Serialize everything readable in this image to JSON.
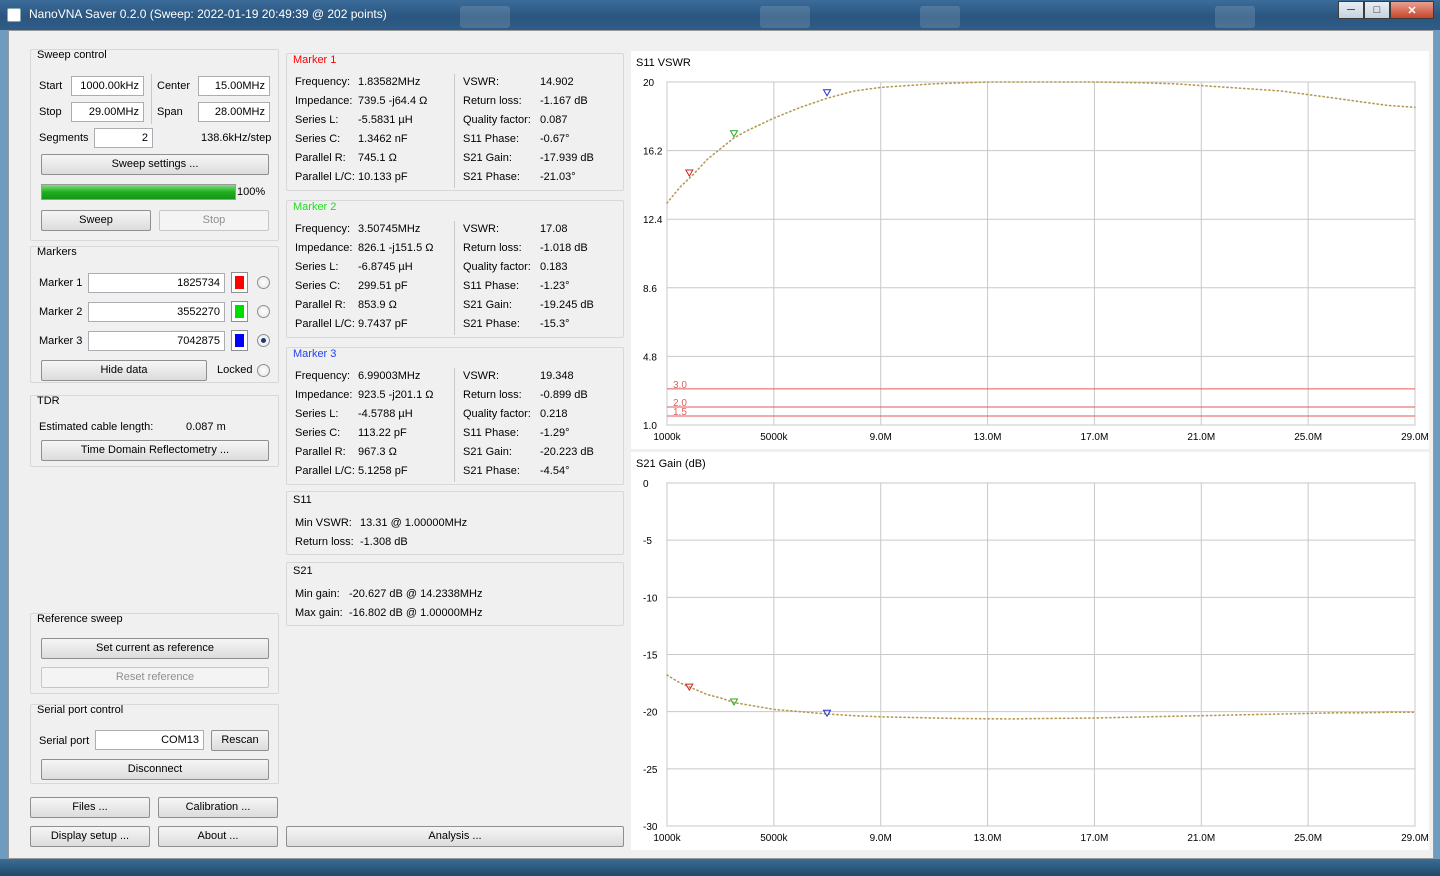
{
  "window": {
    "title": "NanoVNA Saver 0.2.0 (Sweep: 2022-01-19 20:49:39 @ 202 points)",
    "minimize": "─",
    "maximize": "□",
    "close": "✕"
  },
  "sweep": {
    "title": "Sweep control",
    "start_label": "Start",
    "start_value": "1000.00kHz",
    "stop_label": "Stop",
    "stop_value": "29.00MHz",
    "center_label": "Center",
    "center_value": "15.00MHz",
    "span_label": "Span",
    "span_value": "28.00MHz",
    "segments_label": "Segments",
    "segments_value": "2",
    "step": "138.6kHz/step",
    "settings_button": "Sweep settings ...",
    "progress_percent": 100,
    "progress_text": "100%",
    "sweep_button": "Sweep",
    "stop_button": "Stop"
  },
  "markers": {
    "title": "Markers",
    "items": [
      {
        "label": "Marker 1",
        "value": "1825734",
        "color": "#ff0000",
        "selected": false
      },
      {
        "label": "Marker 2",
        "value": "3552270",
        "color": "#00dd00",
        "selected": false
      },
      {
        "label": "Marker 3",
        "value": "7042875",
        "color": "#0000ff",
        "selected": true
      }
    ],
    "hide_button": "Hide data",
    "locked_label": "Locked"
  },
  "tdr": {
    "title": "TDR",
    "cable_label": "Estimated cable length:",
    "cable_value": "0.087 m",
    "button": "Time Domain Reflectometry ..."
  },
  "reference": {
    "title": "Reference sweep",
    "set_button": "Set current as reference",
    "reset_button": "Reset reference"
  },
  "serial": {
    "title": "Serial port control",
    "port_label": "Serial port",
    "port_value": "COM13",
    "rescan_button": "Rescan",
    "disconnect_button": "Disconnect"
  },
  "bottom_buttons": {
    "files": "Files ...",
    "calibration": "Calibration ...",
    "display": "Display setup ...",
    "about": "About ...",
    "analysis": "Analysis ..."
  },
  "marker_data": [
    {
      "title": "Marker 1",
      "title_color": "#ff0000",
      "left": [
        [
          "Frequency:",
          "1.83582MHz"
        ],
        [
          "Impedance:",
          "739.5 -j64.4 Ω"
        ],
        [
          "Series L:",
          "-5.5831 µH"
        ],
        [
          "Series C:",
          "1.3462 nF"
        ],
        [
          "Parallel R:",
          "745.1 Ω"
        ],
        [
          "Parallel L/C:",
          "10.133 pF"
        ]
      ],
      "right": [
        [
          "VSWR:",
          "14.902"
        ],
        [
          "Return loss:",
          "-1.167 dB"
        ],
        [
          "Quality factor:",
          "0.087"
        ],
        [
          "S11 Phase:",
          "-0.67°"
        ],
        [
          "S21 Gain:",
          "-17.939 dB"
        ],
        [
          "S21 Phase:",
          "-21.03°"
        ]
      ]
    },
    {
      "title": "Marker 2",
      "title_color": "#22dd22",
      "left": [
        [
          "Frequency:",
          "3.50745MHz"
        ],
        [
          "Impedance:",
          "826.1 -j151.5 Ω"
        ],
        [
          "Series L:",
          "-6.8745 µH"
        ],
        [
          "Series C:",
          "299.51 pF"
        ],
        [
          "Parallel R:",
          "853.9 Ω"
        ],
        [
          "Parallel L/C:",
          "9.7437 pF"
        ]
      ],
      "right": [
        [
          "VSWR:",
          "17.08"
        ],
        [
          "Return loss:",
          "-1.018 dB"
        ],
        [
          "Quality factor:",
          "0.183"
        ],
        [
          "S11 Phase:",
          "-1.23°"
        ],
        [
          "S21 Gain:",
          "-19.245 dB"
        ],
        [
          "S21 Phase:",
          "-15.3°"
        ]
      ]
    },
    {
      "title": "Marker 3",
      "title_color": "#2244ee",
      "left": [
        [
          "Frequency:",
          "6.99003MHz"
        ],
        [
          "Impedance:",
          "923.5 -j201.1 Ω"
        ],
        [
          "Series L:",
          "-4.5788 µH"
        ],
        [
          "Series C:",
          "113.22 pF"
        ],
        [
          "Parallel R:",
          "967.3 Ω"
        ],
        [
          "Parallel L/C:",
          "5.1258 pF"
        ]
      ],
      "right": [
        [
          "VSWR:",
          "19.348"
        ],
        [
          "Return loss:",
          "-0.899 dB"
        ],
        [
          "Quality factor:",
          "0.218"
        ],
        [
          "S11 Phase:",
          "-1.29°"
        ],
        [
          "S21 Gain:",
          "-20.223 dB"
        ],
        [
          "S21 Phase:",
          "-4.54°"
        ]
      ]
    }
  ],
  "s11_summary": {
    "title": "S11",
    "rows": [
      [
        "Min VSWR:",
        "13.31 @ 1.00000MHz"
      ],
      [
        "Return loss:",
        "-1.308 dB"
      ]
    ]
  },
  "s21_summary": {
    "title": "S21",
    "rows": [
      [
        "Min gain:",
        "-20.627 dB @ 14.2338MHz"
      ],
      [
        "Max gain:",
        "-16.802 dB @ 1.00000MHz"
      ]
    ]
  },
  "chart_data": [
    {
      "type": "line",
      "title": "S11 VSWR",
      "xlabel": "",
      "ylabel": "",
      "xlim": [
        1.0,
        29.0
      ],
      "ylim": [
        1.0,
        20.0
      ],
      "x_ticks": [
        1.0,
        5.0,
        9.0,
        13.0,
        17.0,
        21.0,
        25.0,
        29.0
      ],
      "x_tick_labels": [
        "1000k",
        "5000k",
        "9.0M",
        "13.0M",
        "17.0M",
        "21.0M",
        "25.0M",
        "29.0M"
      ],
      "y_ticks": [
        1.0,
        4.8,
        8.6,
        12.4,
        16.2,
        20
      ],
      "y_tick_labels": [
        "1.0",
        "4.8",
        "8.6",
        "12.4",
        "16.2",
        "20"
      ],
      "reference_lines": [
        {
          "y": 3.0,
          "label": "3.0"
        },
        {
          "y": 2.0,
          "label": "2.0"
        },
        {
          "y": 1.5,
          "label": "1.5"
        }
      ],
      "series_color": "#b59a55",
      "x": [
        1.0,
        1.5,
        2.0,
        2.5,
        3.0,
        3.5,
        4.0,
        5.0,
        6.0,
        7.0,
        8.0,
        9.0,
        10.0,
        11.0,
        12.0,
        13.0,
        14.0,
        15.0,
        16.0,
        17.0,
        18.0,
        19.0,
        20.0,
        21.0,
        22.0,
        23.0,
        24.0,
        25.0,
        26.0,
        27.0,
        28.0,
        29.0
      ],
      "y": [
        13.3,
        14.2,
        14.9,
        15.7,
        16.3,
        16.9,
        17.3,
        18.0,
        18.6,
        19.1,
        19.5,
        19.7,
        19.8,
        19.9,
        19.95,
        20.0,
        20.0,
        20.0,
        20.0,
        20.0,
        19.98,
        19.95,
        19.9,
        19.8,
        19.7,
        19.6,
        19.5,
        19.3,
        19.1,
        18.9,
        18.7,
        18.6
      ],
      "markers": [
        {
          "x": 1.83582,
          "y": 14.902,
          "color": "#cc2222"
        },
        {
          "x": 3.50745,
          "y": 17.08,
          "color": "#22aa22"
        },
        {
          "x": 6.99003,
          "y": 19.348,
          "color": "#2233cc"
        }
      ]
    },
    {
      "type": "line",
      "title": "S21 Gain (dB)",
      "xlabel": "",
      "ylabel": "",
      "xlim": [
        1.0,
        29.0
      ],
      "ylim": [
        -30,
        0
      ],
      "x_ticks": [
        1.0,
        5.0,
        9.0,
        13.0,
        17.0,
        21.0,
        25.0,
        29.0
      ],
      "x_tick_labels": [
        "1000k",
        "5000k",
        "9.0M",
        "13.0M",
        "17.0M",
        "21.0M",
        "25.0M",
        "29.0M"
      ],
      "y_ticks": [
        0,
        -5,
        -10,
        -15,
        -20,
        -25,
        -30
      ],
      "y_tick_labels": [
        "0",
        "-5",
        "-10",
        "-15",
        "-20",
        "-25",
        "-30"
      ],
      "series_color": "#b59a55",
      "x": [
        1.0,
        1.5,
        2.0,
        2.5,
        3.0,
        3.5,
        4.0,
        5.0,
        6.0,
        7.0,
        8.0,
        9.0,
        10.0,
        11.0,
        12.0,
        13.0,
        14.0,
        15.0,
        16.0,
        17.0,
        18.0,
        19.0,
        20.0,
        21.0,
        22.0,
        23.0,
        24.0,
        25.0,
        26.0,
        27.0,
        28.0,
        29.0
      ],
      "y": [
        -16.8,
        -17.5,
        -18.0,
        -18.5,
        -18.8,
        -19.2,
        -19.4,
        -19.8,
        -20.0,
        -20.2,
        -20.35,
        -20.45,
        -20.5,
        -20.55,
        -20.6,
        -20.62,
        -20.63,
        -20.6,
        -20.58,
        -20.55,
        -20.5,
        -20.45,
        -20.4,
        -20.35,
        -20.3,
        -20.25,
        -20.2,
        -20.15,
        -20.1,
        -20.1,
        -20.05,
        -20.05
      ],
      "markers": [
        {
          "x": 1.83582,
          "y": -17.939,
          "color": "#cc2222"
        },
        {
          "x": 3.50745,
          "y": -19.245,
          "color": "#22aa22"
        },
        {
          "x": 6.99003,
          "y": -20.223,
          "color": "#2233cc"
        }
      ]
    }
  ]
}
